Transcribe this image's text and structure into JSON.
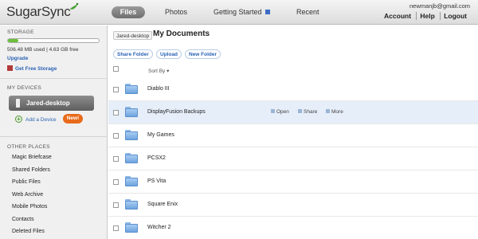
{
  "app": {
    "logo_text": "SugarSync"
  },
  "nav": {
    "files": "Files",
    "photos": "Photos",
    "getting_started": "Getting Started",
    "recent": "Recent"
  },
  "user": {
    "email": "newmanjb@gmail.com",
    "account": "Account",
    "help": "Help",
    "logout": "Logout"
  },
  "sidebar": {
    "storage_title": "STORAGE",
    "storage_used_fraction": 0.11,
    "storage_text": "506.48 MB used | 4.63 GB free",
    "upgrade": "Upgrade",
    "get_free_storage": "Get Free Storage",
    "devices_title": "MY DEVICES",
    "device_name": "Jared-desktop",
    "add_device": "Add a Device",
    "new_badge": "New!",
    "other_title": "OTHER PLACES",
    "places": [
      "Magic Briefcase",
      "Shared Folders",
      "Public Files",
      "Web Archive",
      "Mobile Photos",
      "Contacts",
      "Deleted Files"
    ]
  },
  "main": {
    "breadcrumb": "Jared-desktop",
    "title": "My Documents",
    "actions": {
      "share_folder": "Share Folder",
      "upload": "Upload",
      "new_folder": "New Folder"
    },
    "sort_by": "Sort By ▾",
    "row_actions": {
      "open": "Open",
      "share": "Share",
      "more": "More"
    },
    "folders": [
      "Diablo III",
      "DisplayFusion Backups",
      "My Games",
      "PCSX2",
      "PS Vita",
      "Square Enix",
      "Witcher 2"
    ]
  },
  "colors": {
    "accent": "#2a63b5",
    "storage_fill": "#6cc03a",
    "badge": "#e86a1a",
    "row_highlight": "#e6eef9"
  }
}
